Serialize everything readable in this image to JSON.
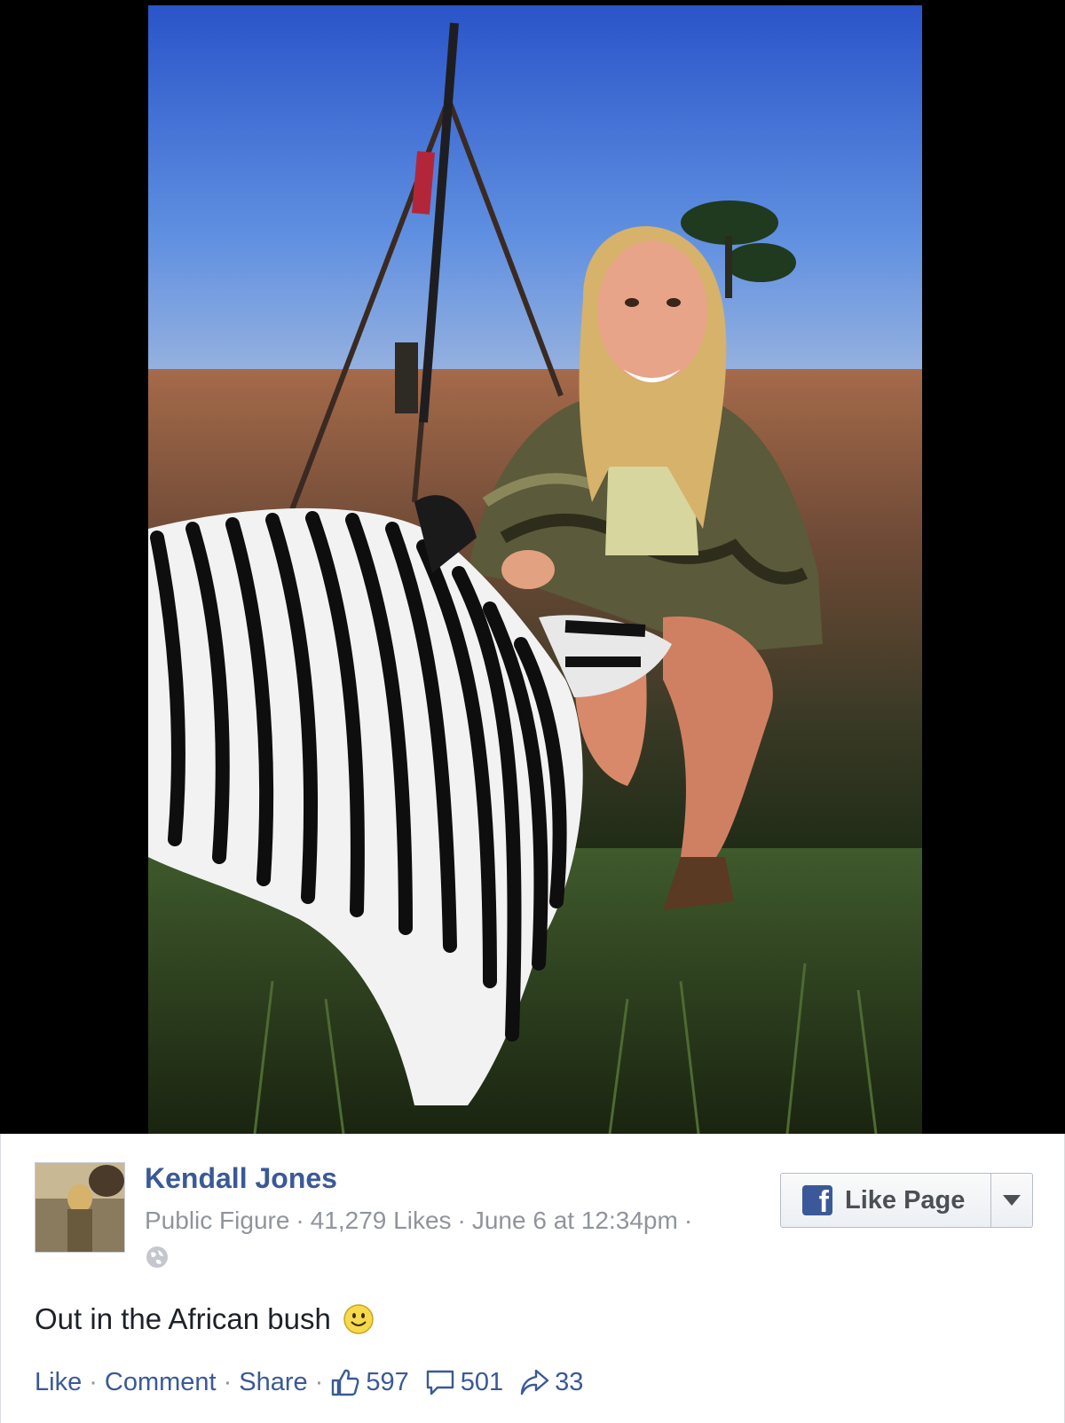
{
  "post": {
    "author": "Kendall Jones",
    "category": "Public Figure",
    "likes": "41,279 Likes",
    "timestamp": "June 6 at 12:34pm",
    "caption": "Out in the African bush",
    "like_page_label": "Like Page",
    "actions": {
      "like": "Like",
      "comment": "Comment",
      "share": "Share"
    },
    "counts": {
      "likes": "597",
      "comments": "501",
      "shares": "33"
    }
  },
  "colors": {
    "link": "#3b5998",
    "meta": "#90949c",
    "text": "#1d2129",
    "photo_frame": "#000000"
  },
  "icons": [
    "globe-icon",
    "facebook-f-icon",
    "dropdown-arrow-icon",
    "smiley-emoji-icon",
    "thumbs-up-icon",
    "comment-bubble-icon",
    "share-arrow-icon"
  ]
}
